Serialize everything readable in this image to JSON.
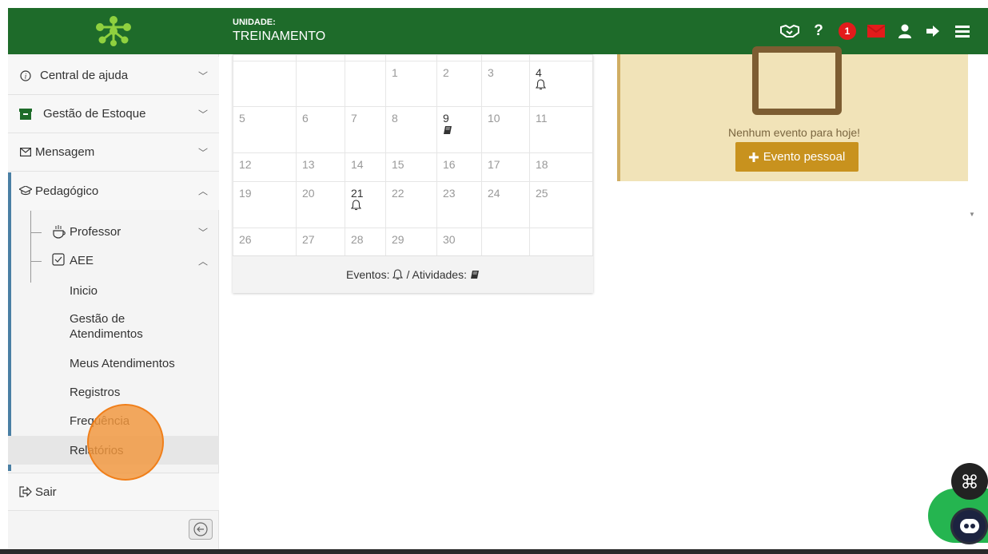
{
  "header": {
    "unit_label": "UNIDADE:",
    "unit_name": "TREINAMENTO",
    "notification_count": "1",
    "help_label": "?"
  },
  "sidebar": {
    "items": [
      {
        "label": "Central de ajuda",
        "icon": "info-icon"
      },
      {
        "label": "Gestão de Estoque",
        "icon": "archive-icon"
      },
      {
        "label": "Mensagem",
        "icon": "envelope-icon"
      },
      {
        "label": "Pedagógico",
        "icon": "graduation-cap-icon"
      }
    ],
    "sub_items": [
      {
        "label": "Professor",
        "icon": "coffee-icon"
      },
      {
        "label": "AEE",
        "icon": "checklist-icon"
      }
    ],
    "aee_links": [
      "Inicio",
      "Gestão de Atendimentos",
      "Meus Atendimentos",
      "Registros",
      "Frequência",
      "Relatórios"
    ],
    "logout_label": "Sair"
  },
  "calendar": {
    "weeks": [
      [
        "",
        "",
        "",
        "1",
        "2",
        "3",
        "4"
      ],
      [
        "5",
        "6",
        "7",
        "8",
        "9",
        "10",
        "11"
      ],
      [
        "12",
        "13",
        "14",
        "15",
        "16",
        "17",
        "18"
      ],
      [
        "19",
        "20",
        "21",
        "22",
        "23",
        "24",
        "25"
      ],
      [
        "26",
        "27",
        "28",
        "29",
        "30",
        "",
        ""
      ]
    ],
    "legend_events": "Eventos:",
    "legend_activities": "/ Atividades:"
  },
  "events_panel": {
    "empty_text": "Nenhum evento para hoje!",
    "button_label": "Evento pessoal"
  }
}
